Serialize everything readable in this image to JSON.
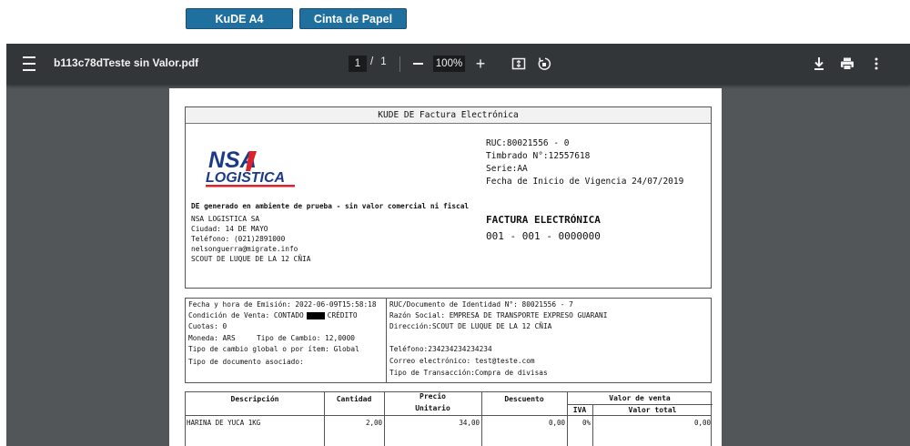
{
  "buttons": {
    "kude_a4": "KuDE A4",
    "cinta": "Cinta de Papel"
  },
  "viewer": {
    "file_name": "b113c78dTeste sin Valor.pdf",
    "current_page": "1",
    "page_sep": "/",
    "total_pages": "1",
    "zoom": "100%",
    "zoom_in": "+"
  },
  "doc": {
    "title": "KUDE DE Factura Electrónica",
    "logo_top": "NSA",
    "logo_bottom": "LOGISTICA",
    "ruc": "RUC:80021556 - 0",
    "timbrado": "Timbrado N°:12557618",
    "serie": "Serie:AA",
    "fecha_vigencia": "Fecha de Inicio de Vigencia 24/07/2019",
    "ambiente": "DE generado en ambiente de prueba - sin valor comercial ni fiscal",
    "emisor_nombre": "NSA LOGISTICA SA",
    "emisor_ciudad": "Ciudad: 14 DE MAYO",
    "emisor_telefono": "Teléfono: (021)2891000",
    "emisor_email": "nelsonguerra@migrate.info",
    "emisor_direccion": "SCOUT DE LUQUE DE LA 12 CÑIA",
    "factura_label": "FACTURA ELECTRÓNICA",
    "factura_numero": "001 - 001 - 0000000",
    "left_info": {
      "fecha_emision": "Fecha y hora de Emisión: 2022-06-09T15:58:18",
      "condicion": "Condición de Venta: CONTADO",
      "credito": "CRÉDITO",
      "cuotas": "Cuotas: 0",
      "moneda": "Moneda: ARS",
      "tipo_cambio": "Tipo de Cambio: 12,0000",
      "tipo_cambio_global": "Tipo de cambio global o por ítem: Global",
      "doc_asociado": "Tipo de documento asociado:"
    },
    "right_info": {
      "ruc_receptor": "RUC/Documento de Identidad N°: 80021556 - 7",
      "razon_social": "Razón Social: EMPRESA DE TRANSPORTE EXPRESO GUARANI",
      "direccion": "Dirección:SCOUT DE LUQUE DE LA 12 CÑIA",
      "telefono": "Teléfono:234234234234234",
      "correo": "Correo electrónico: test@teste.com",
      "tipo_transaccion": "Tipo de Transacción:Compra de divisas"
    },
    "table": {
      "headers": {
        "descripcion": "Descripción",
        "cantidad": "Cantidad",
        "precio_1": "Precio",
        "precio_2": "Unitario",
        "descuento": "Descuento",
        "valor_venta": "Valor de venta",
        "iva": "IVA",
        "valor_total": "Valor total"
      },
      "rows": [
        {
          "descripcion": "HARINA DE YUCA 1KG",
          "cantidad": "2,00",
          "precio": "34,00",
          "descuento": "0,00",
          "iva": "0%",
          "valor_total": "0,00"
        }
      ]
    }
  }
}
